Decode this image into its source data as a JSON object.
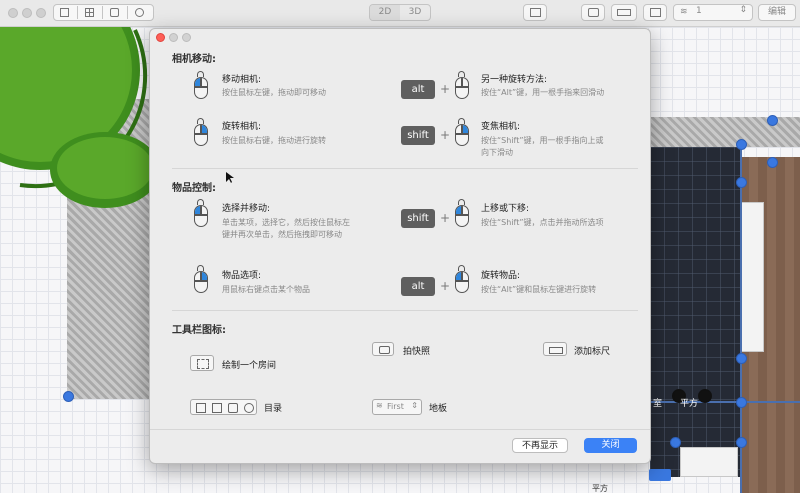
{
  "toolbar": {
    "view_2d": "2D",
    "view_3d": "3D",
    "floor_value": "1",
    "edit_label": "编辑"
  },
  "canvas": {
    "room_label": "室",
    "area_label": "平方",
    "footer_label": "平方"
  },
  "dialog": {
    "camera": {
      "title": "相机移动:",
      "items": [
        {
          "title": "移动相机:",
          "desc": "按住鼠标左键，拖动即可移动"
        },
        {
          "title": "另一种旋转方法:",
          "desc": "按住“Alt”键，用一根手指来回滑动",
          "key": "alt"
        },
        {
          "title": "旋转相机:",
          "desc": "按住鼠标右键，拖动进行旋转"
        },
        {
          "title": "变焦相机:",
          "desc": "按住“Shift”键，用一根手指向上或向下滑动",
          "key": "shift"
        }
      ]
    },
    "objects": {
      "title": "物品控制:",
      "items": [
        {
          "title": "选择并移动:",
          "desc": "单击某项，选择它，然后按住鼠标左键并再次单击，然后拖拽即可移动"
        },
        {
          "title": "上移或下移:",
          "desc": "按住“Shift”键，点击并拖动所选项",
          "key": "shift"
        },
        {
          "title": "物品选项:",
          "desc": "用鼠标右键点击某个物品"
        },
        {
          "title": "旋转物品:",
          "desc": "按住“Alt”键和鼠标左键进行旋转",
          "key": "alt"
        }
      ]
    },
    "toolbar_icons": {
      "title": "工具栏图标:",
      "snapshot": "拍快照",
      "add_ruler": "添加标尺",
      "draw_room": "绘制一个房间",
      "catalog": "目录",
      "floor": "地板",
      "floor_select_value": "First"
    },
    "buttons": {
      "dont_show": "不再显示",
      "close": "关闭"
    }
  },
  "colors": {
    "accent": "#2f86dc",
    "close_button": "#3b82f6",
    "key_bg": "#5f5f5f",
    "tree_green": "#4a9a22"
  }
}
